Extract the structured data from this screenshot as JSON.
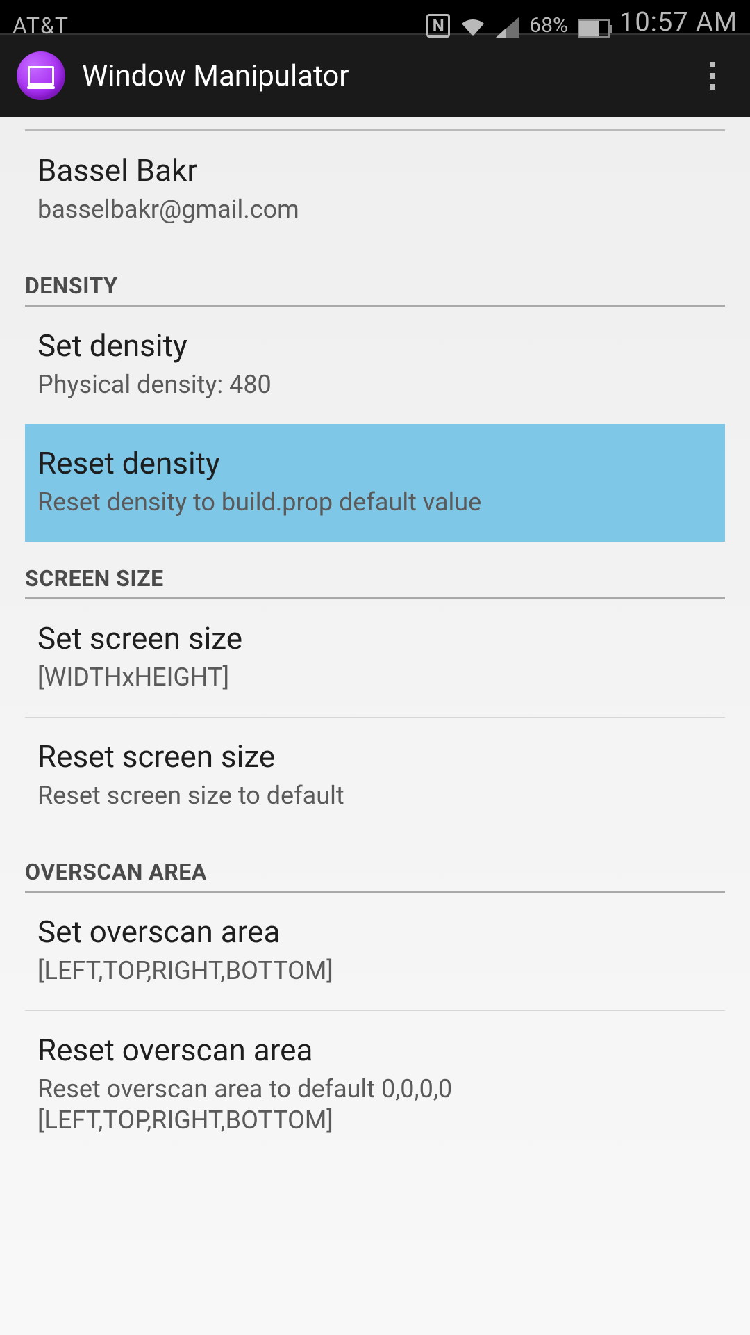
{
  "status_bar": {
    "carrier": "AT&T",
    "battery_pct": "68%",
    "time": "10:57 AM"
  },
  "action_bar": {
    "title": "Window Manipulator"
  },
  "profile": {
    "name": "Bassel Bakr",
    "email": "basselbakr@gmail.com"
  },
  "sections": {
    "density": {
      "header": "DENSITY",
      "set": {
        "title": "Set density",
        "summary": "Physical density: 480"
      },
      "reset": {
        "title": "Reset density",
        "summary": "Reset density to build.prop default value"
      }
    },
    "screen_size": {
      "header": "SCREEN SIZE",
      "set": {
        "title": "Set screen size",
        "summary": " [WIDTHxHEIGHT]"
      },
      "reset": {
        "title": "Reset screen size",
        "summary": "Reset screen size to default"
      }
    },
    "overscan": {
      "header": "OVERSCAN AREA",
      "set": {
        "title": "Set overscan area",
        "summary": "[LEFT,TOP,RIGHT,BOTTOM]"
      },
      "reset": {
        "title": "Reset overscan area",
        "summary": "Reset overscan area to default 0,0,0,0 [LEFT,TOP,RIGHT,BOTTOM]"
      }
    }
  }
}
